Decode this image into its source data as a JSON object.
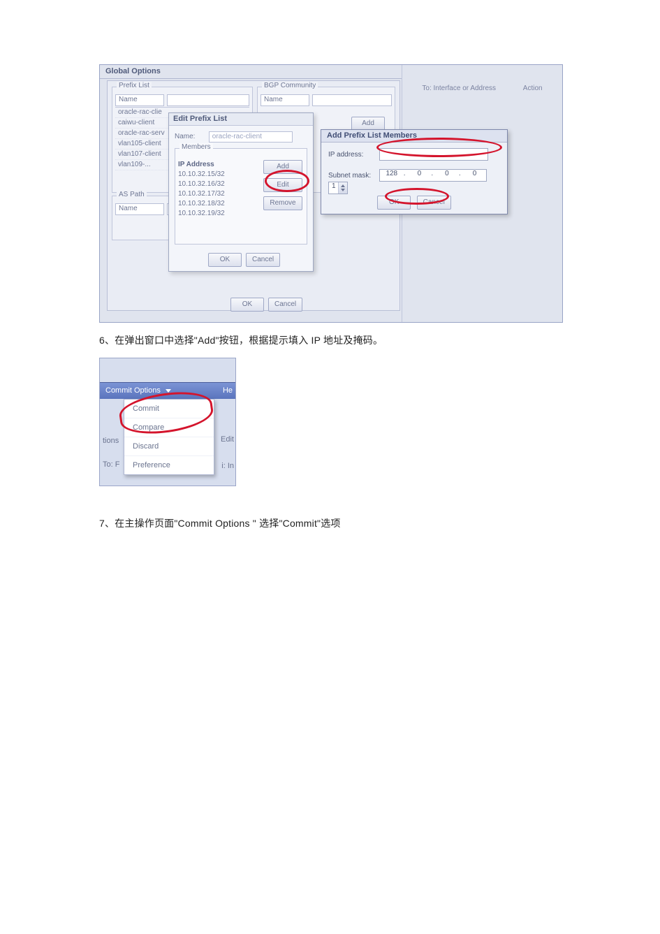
{
  "caption6": "6、在弹出窗口中选择\"Add\"按钮，根据提示填入 IP 地址及掩码。",
  "caption7": "7、在主操作页面\"Commit Options \" 选择\"Commit\"选项",
  "shot1": {
    "title": "Global Options",
    "right_header_left": "To: Interface or Address",
    "right_header_right": "Action",
    "prefix_list": {
      "label": "Prefix List",
      "name_label": "Name",
      "items": [
        "oracle-rac-clie",
        "caiwu-client",
        "oracle-rac-serv",
        "vlan105-client",
        "vlan107-client",
        "vlan109-..."
      ]
    },
    "bgp": {
      "label": "BGP Community",
      "name_label": "Name",
      "add": "Add"
    },
    "as_path": {
      "label": "AS Path",
      "name_label": "Name"
    },
    "outer_ok": "OK",
    "outer_cancel": "Cancel"
  },
  "edit_dialog": {
    "title": "Edit Prefix List",
    "name_label": "Name:",
    "name_value": "oracle-rac-client",
    "members_label": "Members",
    "ip_header": "IP Address",
    "ips": [
      "10.10.32.15/32",
      "10.10.32.16/32",
      "10.10.32.17/32",
      "10.10.32.18/32",
      "10.10.32.19/32"
    ],
    "add": "Add",
    "edit": "Edit",
    "remove": "Remove",
    "ok": "OK",
    "cancel": "Cancel"
  },
  "add_dialog": {
    "title": "Add Prefix List Members",
    "ip_label": "IP address:",
    "subnet_label": "Subnet mask:",
    "subnet": [
      "128",
      "0",
      "0",
      "0"
    ],
    "spin_value": "1",
    "ok": "OK",
    "cancel": "Cancel"
  },
  "shot2": {
    "menu_title": "Commit Options",
    "he": "He",
    "items": [
      "Commit",
      "Compare",
      "Discard",
      "Preference"
    ],
    "frag_left1": "tions",
    "frag_left2": "To: F",
    "frag_right1": "Edit",
    "frag_right2": "i: In"
  }
}
